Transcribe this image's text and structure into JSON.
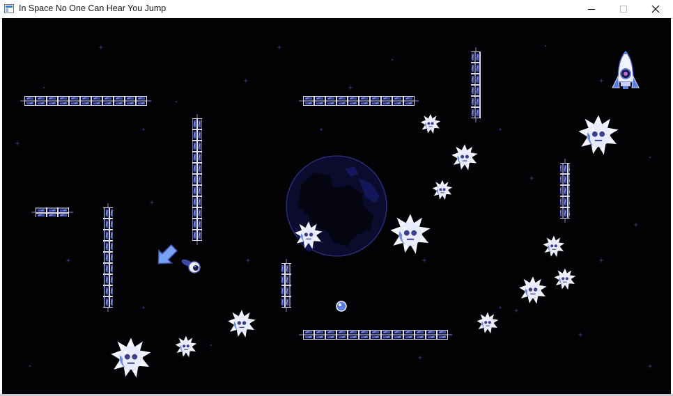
{
  "window": {
    "title": "In Space No One Can Hear You Jump",
    "icon": "app-window-icon",
    "controls": [
      "minimize-icon",
      "maximize-icon",
      "close-icon"
    ]
  },
  "scene": {
    "background_color": "#020204",
    "accent_color": "#5a7ee0",
    "objects": [
      "planet",
      "rocket-goal",
      "player-astronaut",
      "aim-arrow",
      "space-mines",
      "metal-girder-platforms",
      "fuel-orb"
    ]
  }
}
